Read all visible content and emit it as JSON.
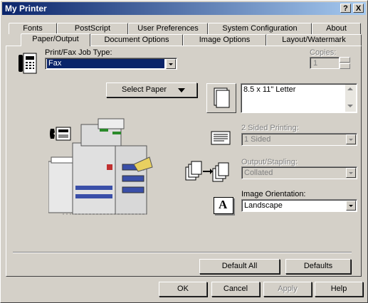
{
  "window": {
    "title": "My Printer",
    "help_label": "?",
    "close_label": "X"
  },
  "tabs_row1": [
    "Fonts",
    "PostScript",
    "User Preferences",
    "System Configuration",
    "About"
  ],
  "tabs_row2": [
    "Paper/Output",
    "Document Options",
    "Image Options",
    "Layout/Watermark"
  ],
  "job_type": {
    "label": "Print/Fax Job Type:",
    "value": "Fax"
  },
  "copies": {
    "label": "Copies:",
    "value": "1"
  },
  "select_paper": {
    "label": "Select Paper"
  },
  "paper_list": {
    "value": "8.5 x 11\" Letter"
  },
  "two_sided": {
    "label": "2 Sided Printing:",
    "value": "1 Sided"
  },
  "output_stapling": {
    "label": "Output/Stapling:",
    "value": "Collated"
  },
  "orientation": {
    "label": "Image Orientation:",
    "value": "Landscape",
    "icon_letter": "A"
  },
  "panel_buttons": {
    "default_all": "Default All",
    "defaults": "Defaults"
  },
  "dialog_buttons": {
    "ok": "OK",
    "cancel": "Cancel",
    "apply": "Apply",
    "help": "Help"
  }
}
